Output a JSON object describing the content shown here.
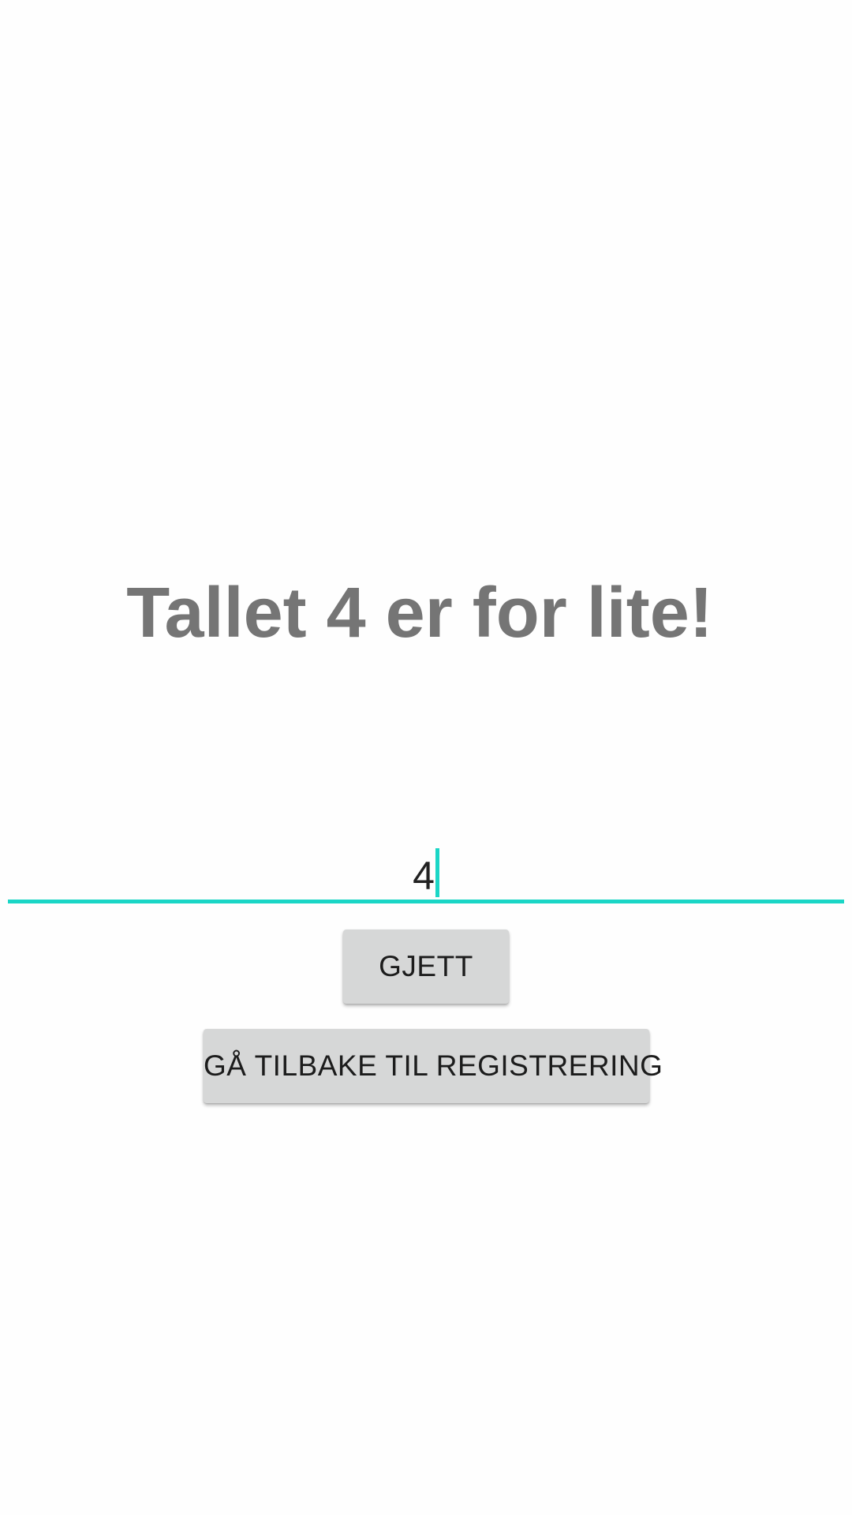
{
  "result": {
    "message": "Tallet 4 er for lite!"
  },
  "guess_input": {
    "value": "4"
  },
  "buttons": {
    "guess_label": "GJETT",
    "back_label": "GÅ TILBAKE TIL REGISTRERING"
  },
  "colors": {
    "accent": "#1ad6c6",
    "message_text": "#757575",
    "button_bg": "#d6d7d7"
  }
}
